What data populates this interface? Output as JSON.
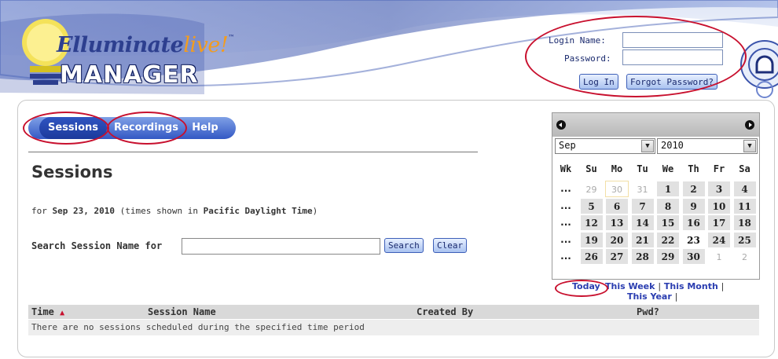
{
  "logo": {
    "top_text": "Elluminate",
    "live_text": "live!",
    "tm": "™",
    "bottom_text": "MANAGER"
  },
  "login": {
    "name_label": "Login Name:",
    "password_label": "Password:",
    "name_value": "",
    "password_value": "",
    "login_button": "Log In",
    "forgot_button": "Forgot Password?"
  },
  "tabs": [
    {
      "label": "Sessions",
      "active": true
    },
    {
      "label": "Recordings",
      "active": false
    },
    {
      "label": "Help",
      "active": false
    }
  ],
  "page": {
    "title": "Sessions",
    "date_prefix": "for ",
    "date": "Sep 23, 2010",
    "date_mid": " (times shown in ",
    "timezone": "Pacific Daylight Time",
    "date_suffix": ")"
  },
  "search": {
    "label": "Search Session Name for",
    "value": "",
    "search_button": "Search",
    "clear_button": "Clear"
  },
  "table": {
    "columns": [
      "Time",
      "Session Name",
      "Created By",
      "Pwd?"
    ],
    "sort_indicator": "▲",
    "empty_message": "There are no sessions scheduled during the specified time period"
  },
  "calendar": {
    "month": "Sep",
    "year": "2010",
    "headers": [
      "Wk",
      "Su",
      "Mo",
      "Tu",
      "We",
      "Th",
      "Fr",
      "Sa"
    ],
    "week_marker": "...",
    "weeks": [
      [
        "29",
        "30",
        "31",
        "1",
        "2",
        "3",
        "4"
      ],
      [
        "5",
        "6",
        "7",
        "8",
        "9",
        "10",
        "11"
      ],
      [
        "12",
        "13",
        "14",
        "15",
        "16",
        "17",
        "18"
      ],
      [
        "19",
        "20",
        "21",
        "22",
        "23",
        "24",
        "25"
      ],
      [
        "26",
        "27",
        "28",
        "29",
        "30",
        "1",
        "2"
      ]
    ],
    "selected_day": "23",
    "links": {
      "today": "Today",
      "this_week": "This Week",
      "this_month": "This Month",
      "this_year": "This Year",
      "separator": "|"
    }
  },
  "colors": {
    "accent": "#3358c4",
    "annotation": "#c8102e",
    "logo_blue": "#2d3f8f",
    "logo_orange": "#f39c1e"
  }
}
